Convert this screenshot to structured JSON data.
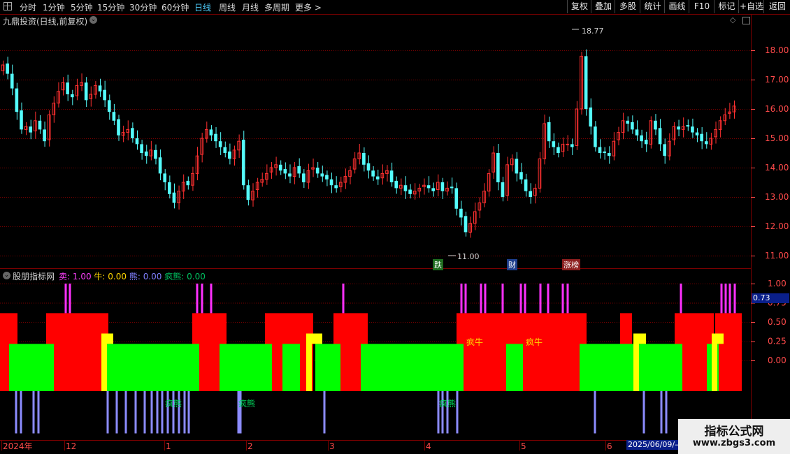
{
  "toolbar": {
    "periods": [
      "分时",
      "1分钟",
      "5分钟",
      "15分钟",
      "30分钟",
      "60分钟",
      "日线",
      "周线",
      "月线",
      "多周期",
      "更多 >"
    ],
    "active_period": "日线",
    "buttons": [
      "复权",
      "叠加",
      "多股",
      "统计",
      "画线",
      "F10",
      "标记",
      "+自选",
      "返回"
    ]
  },
  "main_panel": {
    "title": "九鼎投资(日线,前复权)",
    "price_ticks": [
      "18.00",
      "17.00",
      "16.00",
      "15.00",
      "14.00",
      "13.00",
      "12.00",
      "11.00"
    ],
    "high_label": "18.77",
    "low_label": "11.00",
    "event_tags": [
      {
        "text": "跌",
        "color": "#ffffff",
        "bg": "#1e6b1e"
      },
      {
        "text": "财",
        "color": "#ffffff",
        "bg": "#1e3e8c"
      },
      {
        "text": "涨榜",
        "color": "#ffffff",
        "bg": "#8c1e1e"
      }
    ]
  },
  "indicator_panel": {
    "name": "股朋指标网",
    "legend": [
      {
        "label": "卖:",
        "value": "1.00",
        "color": "#ff40ff"
      },
      {
        "label": "牛:",
        "value": "0.00",
        "color": "#ffd700"
      },
      {
        "label": "熊:",
        "value": "0.00",
        "color": "#8080ff"
      },
      {
        "label": "疯熊:",
        "value": "0.00",
        "color": "#00c060"
      }
    ],
    "ticks": [
      "1.00",
      "0.75",
      "0.50",
      "0.25",
      "0.00"
    ],
    "current_value": "0.73",
    "labels_bull": [
      "疯牛",
      "疯牛"
    ],
    "labels_bear": [
      "疯熊",
      "疯熊",
      "疯熊"
    ]
  },
  "time_axis": {
    "labels": [
      "2024年",
      "12",
      "1",
      "2",
      "3",
      "4",
      "5",
      "6"
    ],
    "cursor_date": "2025/06/09/—"
  },
  "watermark": {
    "title": "指标公式网",
    "url": "www.zbgs3.com"
  },
  "colors": {
    "up": "#ff3030",
    "down": "#54fcfc",
    "grid": "#7a0000",
    "axis_text": "#ff4a4a",
    "bull_block": "#ff0000",
    "bear_block": "#00ff00",
    "yellow_block": "#ffff00"
  }
}
